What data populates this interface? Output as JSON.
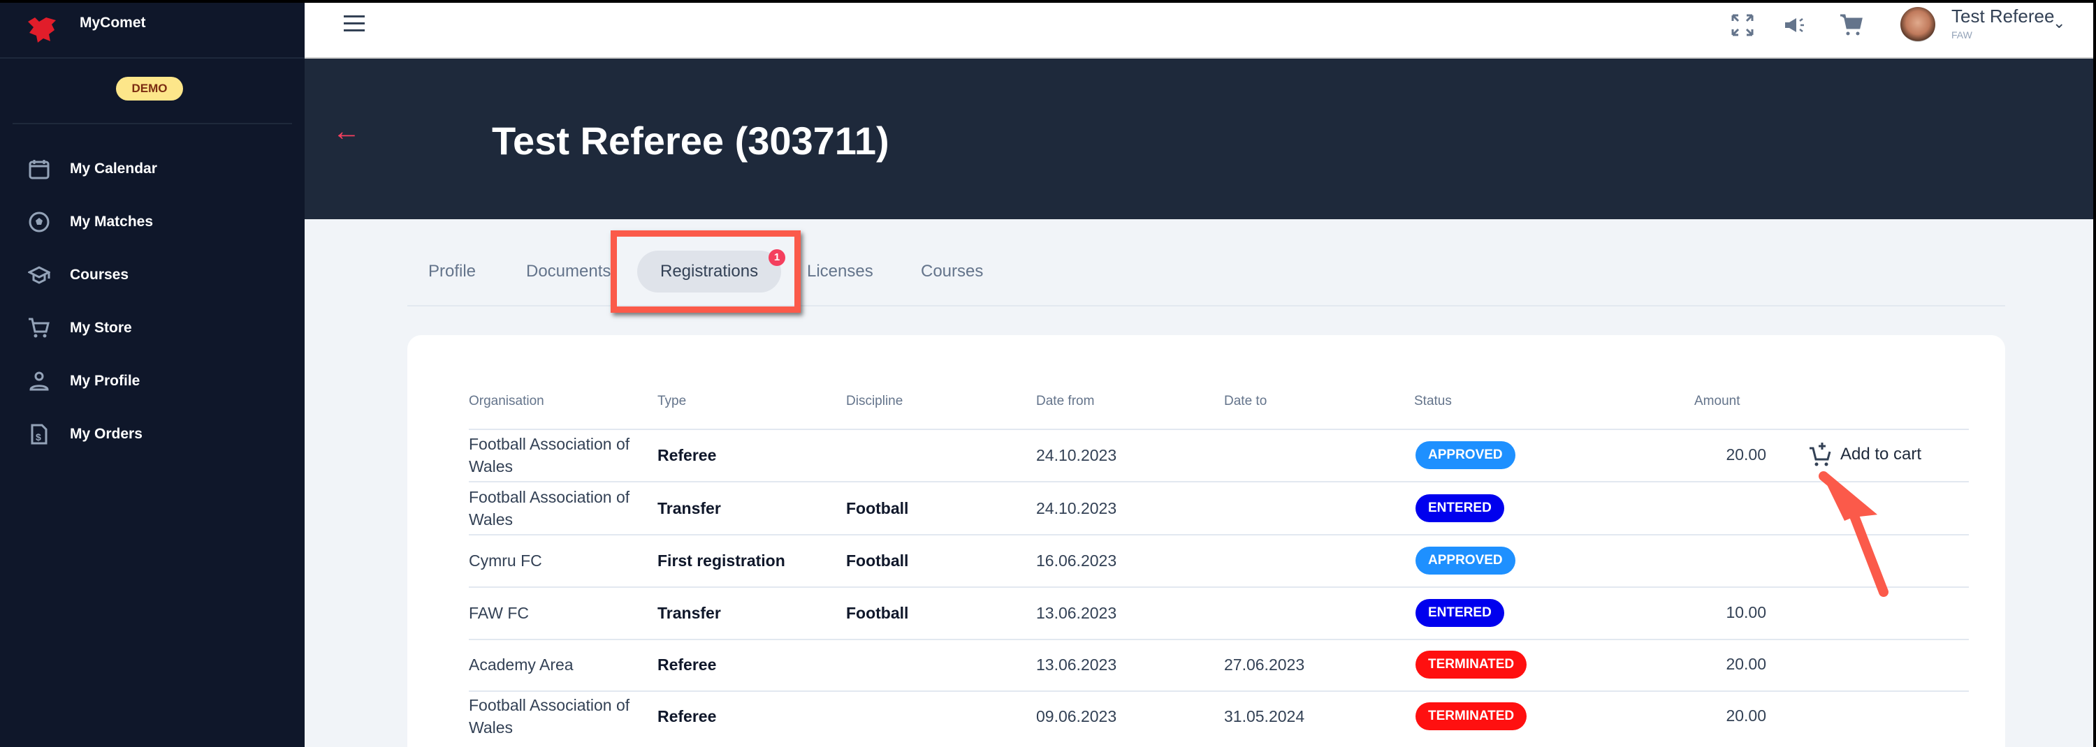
{
  "app": {
    "name": "MyComet",
    "env_badge": "DEMO"
  },
  "sidebar": {
    "items": [
      {
        "label": "My Calendar",
        "icon": "calendar-icon"
      },
      {
        "label": "My Matches",
        "icon": "football-icon"
      },
      {
        "label": "Courses",
        "icon": "graduation-cap-icon"
      },
      {
        "label": "My Store",
        "icon": "cart-icon"
      },
      {
        "label": "My Profile",
        "icon": "user-icon"
      },
      {
        "label": "My Orders",
        "icon": "invoice-icon"
      }
    ]
  },
  "topbar": {
    "user_name": "Test Referee",
    "user_org": "FAW"
  },
  "page": {
    "title": "Test Referee (303711)"
  },
  "tabs": [
    {
      "label": "Profile"
    },
    {
      "label": "Documents"
    },
    {
      "label": "Registrations",
      "badge": "1"
    },
    {
      "label": "Licenses"
    },
    {
      "label": "Courses"
    }
  ],
  "table": {
    "headers": [
      "Organisation",
      "Type",
      "Discipline",
      "Date from",
      "Date to",
      "Status",
      "Amount"
    ],
    "add_to_cart_label": "Add to cart",
    "rows": [
      {
        "org": "Football Association of Wales",
        "type": "Referee",
        "discipline": "",
        "from": "24.10.2023",
        "to": "",
        "status": "APPROVED",
        "amount": "20.00"
      },
      {
        "org": "Football Association of Wales",
        "type": "Transfer",
        "discipline": "Football",
        "from": "24.10.2023",
        "to": "",
        "status": "ENTERED",
        "amount": ""
      },
      {
        "org": "Cymru FC",
        "type": "First registration",
        "discipline": "Football",
        "from": "16.06.2023",
        "to": "",
        "status": "APPROVED",
        "amount": ""
      },
      {
        "org": "FAW FC",
        "type": "Transfer",
        "discipline": "Football",
        "from": "13.06.2023",
        "to": "",
        "status": "ENTERED",
        "amount": "10.00"
      },
      {
        "org": "Academy Area",
        "type": "Referee",
        "discipline": "",
        "from": "13.06.2023",
        "to": "27.06.2023",
        "status": "TERMINATED",
        "amount": "20.00"
      },
      {
        "org": "Football Association of Wales",
        "type": "Referee",
        "discipline": "",
        "from": "09.06.2023",
        "to": "31.05.2024",
        "status": "TERMINATED",
        "amount": "20.00"
      }
    ]
  },
  "status_colors": {
    "APPROVED": "#1e90ff",
    "ENTERED": "#0000ee",
    "TERMINATED": "#ff1010"
  }
}
